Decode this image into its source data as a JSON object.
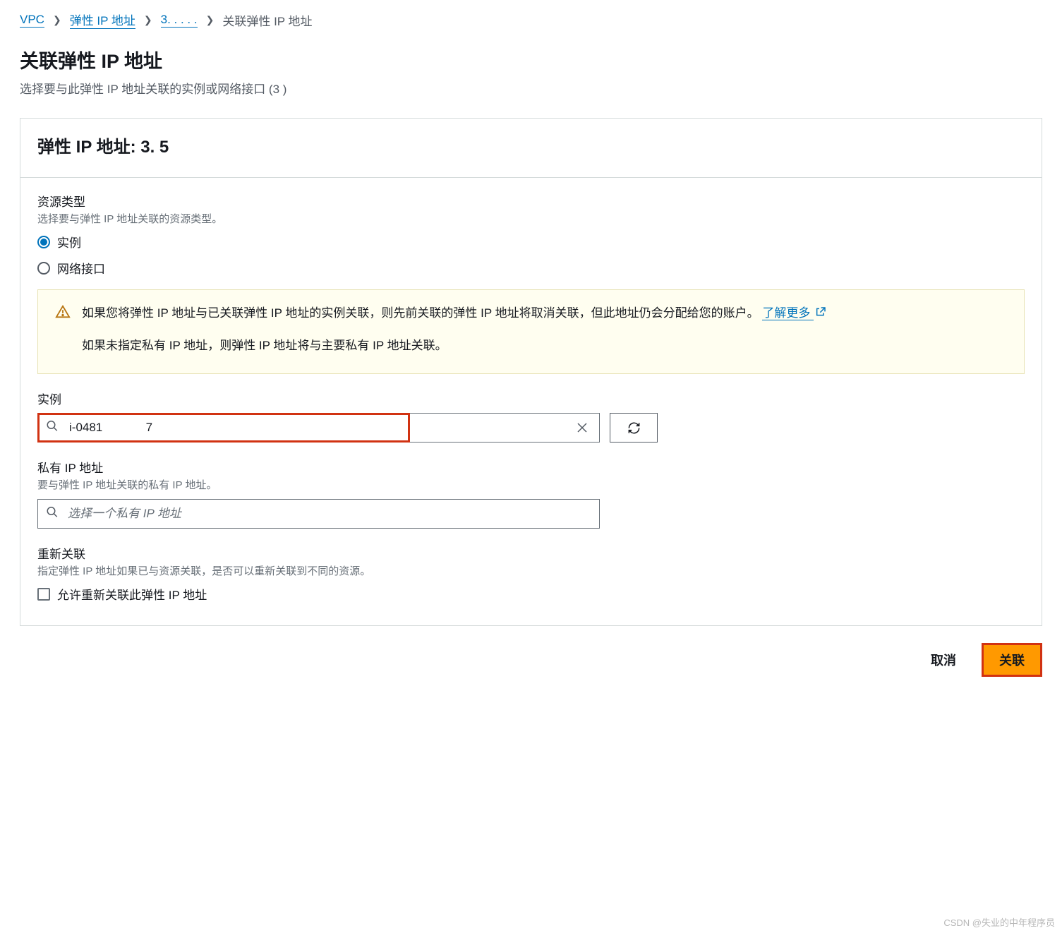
{
  "breadcrumb": {
    "vpc": "VPC",
    "eip": "弹性 IP 地址",
    "ip_id": "3. .   .  .   .",
    "current": "关联弹性 IP 地址"
  },
  "header": {
    "title": "关联弹性 IP 地址",
    "desc": "选择要与此弹性 IP 地址关联的实例或网络接口 (3                  )"
  },
  "panel": {
    "title": "弹性 IP 地址: 3.            5"
  },
  "resource_type": {
    "label": "资源类型",
    "sub": "选择要与弹性 IP 地址关联的资源类型。",
    "option_instance": "实例",
    "option_interface": "网络接口"
  },
  "info": {
    "p1a": "如果您将弹性 IP 地址与已关联弹性 IP 地址的实例关联，则先前关联的弹性 IP 地址将取消关联，但此地址仍会分配给您的账户。",
    "learn": "了解更多",
    "p2": "如果未指定私有 IP 地址，则弹性 IP 地址将与主要私有 IP 地址关联。"
  },
  "instance": {
    "label": "实例",
    "value": "i-0481             7"
  },
  "private_ip": {
    "label": "私有 IP 地址",
    "sub": "要与弹性 IP 地址关联的私有 IP 地址。",
    "placeholder": "选择一个私有 IP 地址"
  },
  "reassociate": {
    "label": "重新关联",
    "sub": "指定弹性 IP 地址如果已与资源关联，是否可以重新关联到不同的资源。",
    "checkbox": "允许重新关联此弹性 IP 地址"
  },
  "actions": {
    "cancel": "取消",
    "associate": "关联"
  },
  "watermark": "CSDN @失业的中年程序员"
}
